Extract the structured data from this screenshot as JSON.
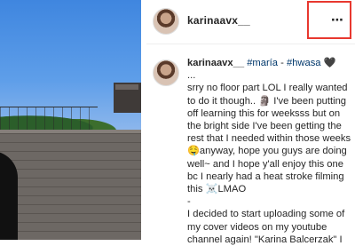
{
  "post": {
    "username": "karinaavx__",
    "more_icon": "⋯",
    "caption": {
      "username": "karinaavx__",
      "hashtags": [
        " #maría",
        " - ",
        "#hwasa",
        " 🖤"
      ],
      "lines": [
        "...",
        "srry no floor part LOL I really wanted",
        "to do it though.. 🗿 I've been putting",
        "off learning this for weeksss but on",
        "the bright side I've been getting the",
        "rest that I needed within those weeks",
        "🤤anyway, hope you guys are doing",
        "well~ and I hope y'all enjoy this one",
        "bc I nearly had a heat stroke filming",
        "this ☠️LMAO",
        "-",
        "I decided to start uploading some of",
        "my cover videos on my youtube",
        "channel again! \"Karina Balcerzak\" I"
      ]
    }
  }
}
